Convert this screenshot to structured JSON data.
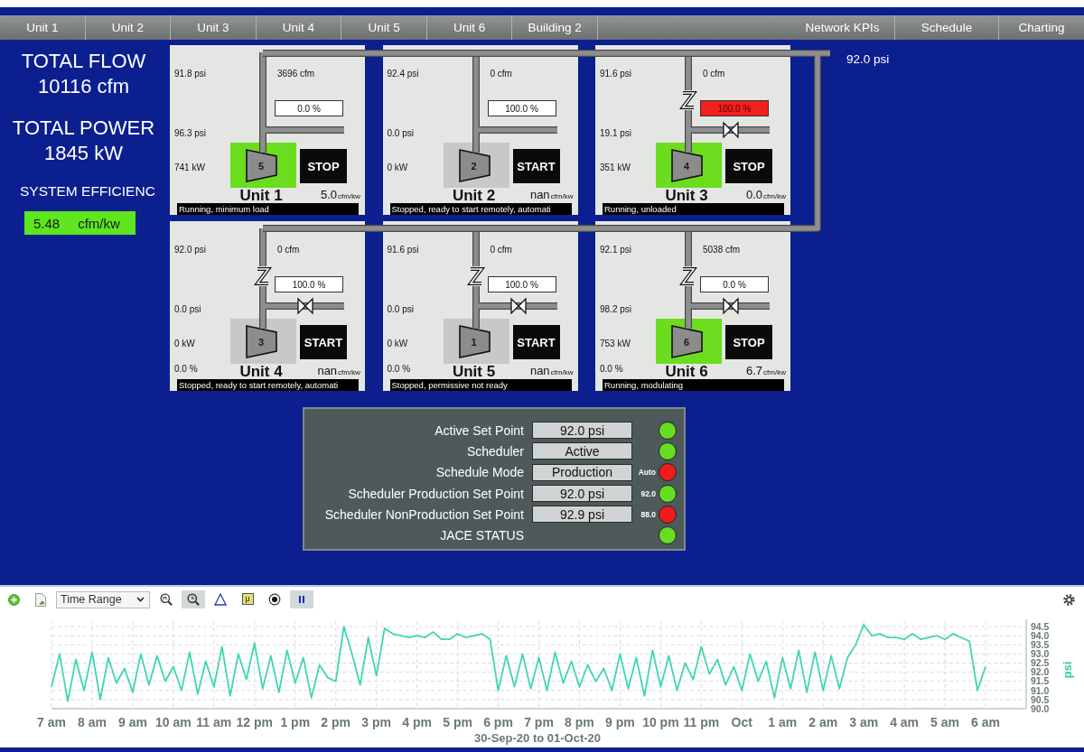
{
  "nav": {
    "left_tabs": [
      {
        "label": "Unit 1",
        "selected": false
      },
      {
        "label": "Unit 2",
        "selected": false
      },
      {
        "label": "Unit 3",
        "selected": false
      },
      {
        "label": "Unit 4",
        "selected": false
      },
      {
        "label": "Unit 5",
        "selected": false
      },
      {
        "label": "Unit 6",
        "selected": false
      },
      {
        "label": "Building 2",
        "selected": false
      }
    ],
    "right_tabs": [
      {
        "label": "Network KPIs",
        "selected": false
      },
      {
        "label": "Schedule",
        "selected": false
      },
      {
        "label": "Charting",
        "selected": false
      }
    ]
  },
  "summary": {
    "flow_title": "TOTAL FLOW",
    "flow_value": "10116 cfm",
    "power_title": "TOTAL POWER",
    "power_value": "1845 kW",
    "efficiency_title": "SYSTEM EFFICIENC",
    "efficiency_value": "5.48",
    "efficiency_unit": "cfm/kw"
  },
  "header_pressure": "92.0 psi",
  "units": [
    {
      "name": "Unit 1",
      "number": "5",
      "running": true,
      "button": "STOP",
      "inlet_pressure": "91.8 psi",
      "flow": "3696 cfm",
      "capacity": "0.0 %",
      "capacity_alarm": false,
      "discharge_pressure": "96.3 psi",
      "power": "741 kW",
      "efficiency": "5.0",
      "efficiency_unit": "cfm/kw",
      "status": "Running, minimum load",
      "check_valve": false,
      "valve": false
    },
    {
      "name": "Unit 2",
      "number": "2",
      "running": false,
      "button": "START",
      "inlet_pressure": "92.4 psi",
      "flow": "0 cfm",
      "capacity": "100.0 %",
      "capacity_alarm": false,
      "discharge_pressure": "0.0 psi",
      "power": "0 kW",
      "efficiency": "nan",
      "efficiency_unit": "cfm/kw",
      "status": "Stopped, ready to start remotely, automati",
      "check_valve": false,
      "valve": false
    },
    {
      "name": "Unit 3",
      "number": "4",
      "running": true,
      "button": "STOP",
      "inlet_pressure": "91.6 psi",
      "flow": "0 cfm",
      "capacity": "100.0 %",
      "capacity_alarm": true,
      "discharge_pressure": "19.1 psi",
      "power": "351 kW",
      "efficiency": "0.0",
      "efficiency_unit": "cfm/kw",
      "status": "Running, unloaded",
      "check_valve": true,
      "valve": true
    },
    {
      "name": "Unit 4",
      "number": "3",
      "running": false,
      "button": "START",
      "inlet_pressure": "92.0 psi",
      "flow": "0 cfm",
      "capacity": "100.0 %",
      "capacity_alarm": false,
      "discharge_pressure": "0.0 psi",
      "power": "0 kW",
      "load": "0.0 %",
      "efficiency": "nan",
      "efficiency_unit": "cfm/kw",
      "status": "Stopped, ready to start remotely, automati",
      "check_valve": true,
      "valve": true
    },
    {
      "name": "Unit 5",
      "number": "1",
      "running": false,
      "button": "START",
      "inlet_pressure": "91.6 psi",
      "flow": "0 cfm",
      "capacity": "100.0 %",
      "capacity_alarm": false,
      "discharge_pressure": "0.0 psi",
      "power": "0 kW",
      "load": "0.0 %",
      "efficiency": "nan",
      "efficiency_unit": "cfm/kw",
      "status": "Stopped, permissive not ready",
      "check_valve": true,
      "valve": true
    },
    {
      "name": "Unit 6",
      "number": "6",
      "running": true,
      "button": "STOP",
      "inlet_pressure": "92.1 psi",
      "flow": "5038 cfm",
      "capacity": "0.0 %",
      "capacity_alarm": false,
      "discharge_pressure": "98.2 psi",
      "power": "753 kW",
      "load": "0.0 %",
      "efficiency": "6.7",
      "efficiency_unit": "cfm/kw",
      "status": "Running, modulating",
      "check_valve": true,
      "valve": true
    }
  ],
  "scheduler_panel": {
    "rows": [
      {
        "label": "Active Set Point",
        "value": "92.0 psi",
        "color": "#66dd22"
      },
      {
        "label": "Scheduler",
        "value": "Active",
        "color": "#66dd22"
      },
      {
        "label": "Schedule Mode",
        "value": "Production",
        "note": "Auto",
        "color": "#ee1c1c"
      },
      {
        "label": "Scheduler Production Set Point",
        "value": "92.0 psi",
        "note": "92.0",
        "color": "#66dd22"
      },
      {
        "label": "Scheduler NonProduction Set Point",
        "value": "92.9 psi",
        "note": "88.0",
        "color": "#ee1c1c"
      },
      {
        "label": "JACE STATUS",
        "color": "#66dd22"
      }
    ]
  },
  "trend": {
    "toolbar": {
      "actions": [
        {
          "kind": "add"
        },
        {
          "kind": "export"
        }
      ],
      "time_range": "Time Range",
      "tools": [
        {
          "kind": "zoom_reset",
          "selected": false
        },
        {
          "kind": "zoom",
          "selected": true
        },
        {
          "kind": "delta",
          "selected": false
        },
        {
          "kind": "statistics",
          "label": "μ",
          "selected": false
        },
        {
          "kind": "marker",
          "selected": false
        },
        {
          "kind": "pause",
          "selected": true
        }
      ]
    },
    "chart_data": {
      "type": "line",
      "xlabel": "30-Sep-20 to 01-Oct-20",
      "ylabel": "psi",
      "grid": true,
      "categories": [
        "7 am",
        null,
        null,
        null,
        null,
        "8 am",
        null,
        null,
        null,
        null,
        "9 am",
        null,
        null,
        null,
        null,
        "10 am",
        null,
        null,
        null,
        null,
        "11 am",
        null,
        null,
        null,
        null,
        "12 pm",
        null,
        null,
        null,
        null,
        "1 pm",
        null,
        null,
        null,
        null,
        "2 pm",
        null,
        null,
        null,
        null,
        "3 pm",
        null,
        null,
        null,
        null,
        "4 pm",
        null,
        null,
        null,
        null,
        "5 pm",
        null,
        null,
        null,
        null,
        "6 pm",
        null,
        null,
        null,
        null,
        "7 pm",
        null,
        null,
        null,
        null,
        "8 pm",
        null,
        null,
        null,
        null,
        "9 pm",
        null,
        null,
        null,
        null,
        "10 pm",
        null,
        null,
        null,
        null,
        "11 pm",
        null,
        null,
        null,
        null,
        "Oct",
        null,
        null,
        null,
        null,
        "1 am",
        null,
        null,
        null,
        null,
        "2 am",
        null,
        null,
        null,
        null,
        "3 am",
        null,
        null,
        null,
        null,
        "4 am",
        null,
        null,
        null,
        null,
        "5 am",
        null,
        null,
        null,
        null,
        "6 am"
      ],
      "ylim": [
        90,
        94.8
      ],
      "yticks": [
        {
          "value": 90,
          "label": "90.0"
        },
        {
          "value": 90.5,
          "label": "90.5"
        },
        {
          "value": 91,
          "label": "91.0"
        },
        {
          "value": 91.5,
          "label": "91.5"
        },
        {
          "value": 92,
          "label": "92.0"
        },
        {
          "value": 92.5,
          "label": "92.5"
        },
        {
          "value": 93,
          "label": "93.0"
        },
        {
          "value": 93.5,
          "label": "93.5"
        },
        {
          "value": 94,
          "label": "94.0"
        },
        {
          "value": 94.5,
          "label": "94.5"
        }
      ],
      "series": [
        {
          "color": "#3fd6b2",
          "values": [
            91.2,
            93.0,
            90.4,
            92.7,
            91.0,
            93.1,
            90.5,
            92.8,
            91.4,
            92.2,
            90.9,
            93.0,
            91.3,
            92.9,
            91.5,
            92.3,
            91.0,
            93.1,
            90.8,
            92.6,
            91.2,
            93.4,
            90.7,
            93.0,
            91.6,
            93.6,
            91.1,
            92.9,
            90.9,
            93.2,
            91.4,
            92.8,
            90.6,
            92.4,
            91.7,
            91.5,
            94.5,
            93.0,
            91.3,
            93.9,
            91.8,
            94.4,
            94.1,
            94.0,
            93.9,
            94.0,
            93.9,
            94.2,
            93.8,
            93.8,
            94.1,
            93.9,
            94.0,
            94.1,
            93.8,
            91.0,
            92.9,
            91.2,
            93.0,
            91.1,
            92.8,
            91.0,
            93.1,
            91.4,
            92.6,
            91.2,
            92.4,
            91.5,
            92.2,
            91.0,
            93.0,
            91.1,
            92.8,
            90.7,
            93.2,
            91.2,
            92.9,
            91.0,
            92.5,
            91.6,
            93.4,
            91.9,
            92.7,
            91.3,
            92.3,
            91.0,
            93.0,
            91.5,
            92.6,
            90.6,
            92.8,
            91.1,
            93.2,
            90.9,
            93.1,
            91.0,
            92.9,
            91.1,
            92.8,
            93.5,
            94.6,
            94.0,
            94.1,
            93.9,
            93.9,
            93.8,
            94.1,
            93.8,
            93.9,
            94.0,
            93.8,
            94.1,
            93.9,
            93.7,
            91.0,
            92.3
          ]
        }
      ]
    }
  }
}
